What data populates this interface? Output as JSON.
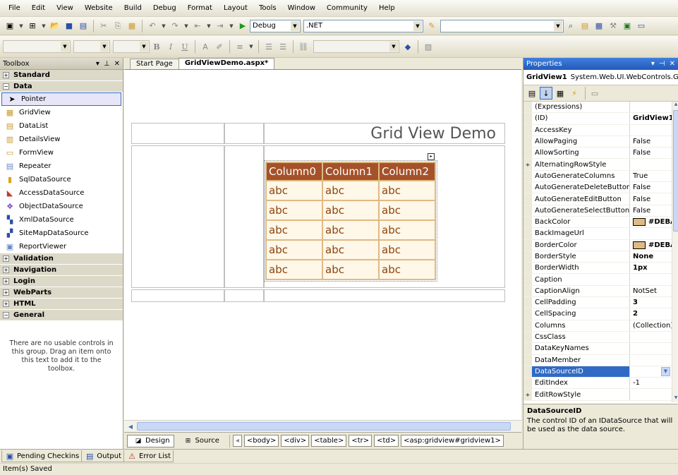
{
  "menu": [
    "File",
    "Edit",
    "View",
    "Website",
    "Build",
    "Debug",
    "Format",
    "Layout",
    "Tools",
    "Window",
    "Community",
    "Help"
  ],
  "toolbar": {
    "config_combo": "Debug",
    "platform_combo": ".NET",
    "bold_label": "B",
    "italic_label": "I",
    "underline_label": "U"
  },
  "toolbox": {
    "title": "Toolbox",
    "categories": {
      "standard": "Standard",
      "data": "Data",
      "validation": "Validation",
      "navigation": "Navigation",
      "login": "Login",
      "webparts": "WebParts",
      "html": "HTML",
      "general": "General"
    },
    "items": [
      "Pointer",
      "GridView",
      "DataList",
      "DetailsView",
      "FormView",
      "Repeater",
      "SqlDataSource",
      "AccessDataSource",
      "ObjectDataSource",
      "XmlDataSource",
      "SiteMapDataSource",
      "ReportViewer"
    ],
    "empty_message": "There are no usable controls in this group. Drag an item onto this text to add it to the toolbox."
  },
  "editor": {
    "tabs": [
      "Start Page",
      "GridViewDemo.aspx*"
    ],
    "page_heading": "Grid View Demo",
    "grid": {
      "headers": [
        "Column0",
        "Column1",
        "Column2"
      ],
      "rows": [
        [
          "abc",
          "abc",
          "abc"
        ],
        [
          "abc",
          "abc",
          "abc"
        ],
        [
          "abc",
          "abc",
          "abc"
        ],
        [
          "abc",
          "abc",
          "abc"
        ],
        [
          "abc",
          "abc",
          "abc"
        ]
      ],
      "header_color": "#A55129",
      "row_back_color": "#FFF7E7",
      "row_fore_color": "#8C4510",
      "border_color": "#DEBA84"
    },
    "views": {
      "design": "Design",
      "source": "Source"
    },
    "breadcrumbs": [
      "<body>",
      "<div>",
      "<table>",
      "<tr>",
      "<td>",
      "<asp:gridview#gridview1>"
    ]
  },
  "properties": {
    "title": "Properties",
    "object_name": "GridView1",
    "object_type": "System.Web.UI.WebControls.Gr",
    "rows": [
      {
        "expand": "",
        "name": "(Expressions)",
        "value": ""
      },
      {
        "expand": "",
        "name": "(ID)",
        "value": "GridView1",
        "bold": true
      },
      {
        "expand": "",
        "name": "AccessKey",
        "value": ""
      },
      {
        "expand": "",
        "name": "AllowPaging",
        "value": "False"
      },
      {
        "expand": "",
        "name": "AllowSorting",
        "value": "False"
      },
      {
        "expand": "+",
        "name": "AlternatingRowStyle",
        "value": ""
      },
      {
        "expand": "",
        "name": "AutoGenerateColumns",
        "value": "True"
      },
      {
        "expand": "",
        "name": "AutoGenerateDeleteButton",
        "value": "False"
      },
      {
        "expand": "",
        "name": "AutoGenerateEditButton",
        "value": "False"
      },
      {
        "expand": "",
        "name": "AutoGenerateSelectButton",
        "value": "False"
      },
      {
        "expand": "",
        "name": "BackColor",
        "value": "#DEBA",
        "bold": true,
        "swatch": "#DEBA84"
      },
      {
        "expand": "",
        "name": "BackImageUrl",
        "value": ""
      },
      {
        "expand": "",
        "name": "BorderColor",
        "value": "#DEBA",
        "bold": true,
        "swatch": "#DEBA84"
      },
      {
        "expand": "",
        "name": "BorderStyle",
        "value": "None",
        "bold": true
      },
      {
        "expand": "",
        "name": "BorderWidth",
        "value": "1px",
        "bold": true
      },
      {
        "expand": "",
        "name": "Caption",
        "value": ""
      },
      {
        "expand": "",
        "name": "CaptionAlign",
        "value": "NotSet"
      },
      {
        "expand": "",
        "name": "CellPadding",
        "value": "3",
        "bold": true
      },
      {
        "expand": "",
        "name": "CellSpacing",
        "value": "2",
        "bold": true
      },
      {
        "expand": "",
        "name": "Columns",
        "value": "(Collection)"
      },
      {
        "expand": "",
        "name": "CssClass",
        "value": ""
      },
      {
        "expand": "",
        "name": "DataKeyNames",
        "value": ""
      },
      {
        "expand": "",
        "name": "DataMember",
        "value": ""
      },
      {
        "expand": "",
        "name": "DataSourceID",
        "value": "",
        "selected": true
      },
      {
        "expand": "",
        "name": "EditIndex",
        "value": "-1"
      },
      {
        "expand": "+",
        "name": "EditRowStyle",
        "value": ""
      }
    ],
    "description_title": "DataSourceID",
    "description_text": "The control ID of an IDataSource that will be used as the data source."
  },
  "bottom_tabs": [
    "Pending Checkins",
    "Output",
    "Error List"
  ],
  "status": "Item(s) Saved"
}
